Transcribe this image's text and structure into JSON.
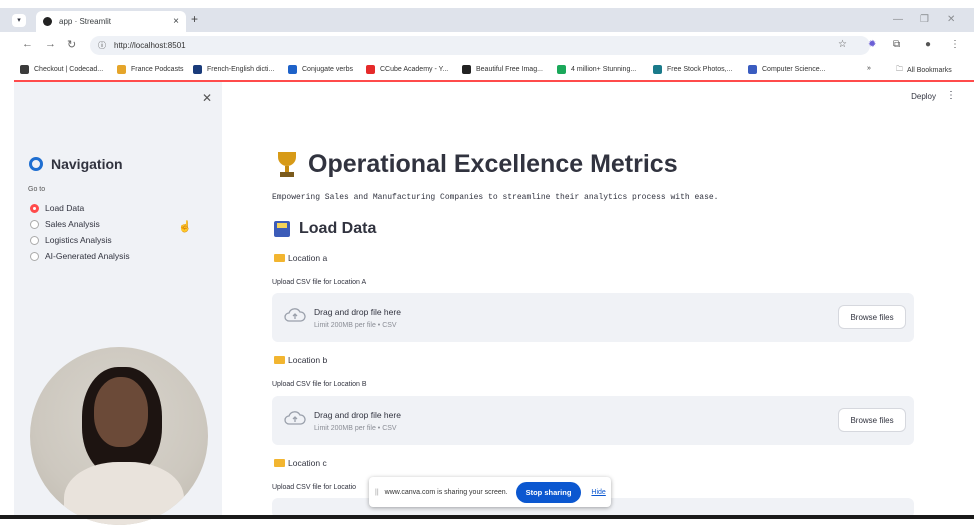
{
  "browser": {
    "tab_title": "app · Streamlit",
    "url": "http://localhost:8501",
    "bookmarks": [
      {
        "label": "Checkout | Codecad...",
        "color": "#3b3b3b"
      },
      {
        "label": "France Podcasts",
        "color": "#e5a52a"
      },
      {
        "label": "French-English dicti...",
        "color": "#1a3b7a"
      },
      {
        "label": "Conjugate verbs",
        "color": "#1e62c9"
      },
      {
        "label": "CCube Academy - Y...",
        "color": "#e52a2a"
      },
      {
        "label": "Beautiful Free Imag...",
        "color": "#222222"
      },
      {
        "label": "4 million+ Stunning...",
        "color": "#1aa85a"
      },
      {
        "label": "Free Stock Photos,...",
        "color": "#1a7a8a"
      },
      {
        "label": "Computer Science...",
        "color": "#3a5cc0"
      }
    ],
    "all_bookmarks": "All Bookmarks"
  },
  "sidebar": {
    "title": "Navigation",
    "goto_label": "Go to",
    "options": [
      "Load Data",
      "Sales Analysis",
      "Logistics Analysis",
      "AI-Generated Analysis"
    ],
    "selected": "Load Data"
  },
  "header": {
    "deploy": "Deploy"
  },
  "main": {
    "title": "Operational Excellence Metrics",
    "subtitle": "Empowering Sales and Manufacturing Companies to streamline their analytics process with ease.",
    "section": "Load Data",
    "locations": [
      {
        "name": "Location a",
        "upload_label": "Upload CSV file for Location A"
      },
      {
        "name": "Location b",
        "upload_label": "Upload CSV file for Location B"
      },
      {
        "name": "Location c",
        "upload_label": "Upload CSV file for Locatio"
      }
    ],
    "drop_text": "Drag and drop file here",
    "limit_text": "Limit 200MB per file • CSV",
    "browse_label": "Browse files"
  },
  "share_bar": {
    "message": "www.canva.com is sharing your screen.",
    "stop": "Stop sharing",
    "hide": "Hide"
  }
}
